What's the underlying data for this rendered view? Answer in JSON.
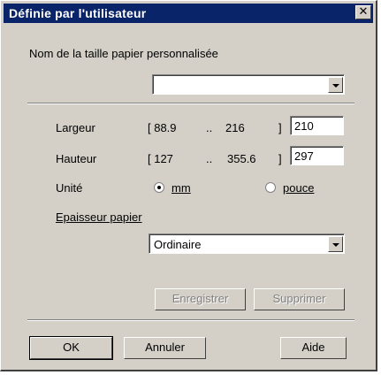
{
  "dialog": {
    "title": "Définie par l'utilisateur",
    "close_glyph": "✕"
  },
  "paper_name": {
    "label": "Nom de la taille papier personnalisée",
    "value": ""
  },
  "largeur": {
    "label": "Largeur",
    "range_min": "[ 88.9",
    "range_sep": "..",
    "range_max": "216",
    "range_close": "]",
    "value": "210"
  },
  "hauteur": {
    "label": "Hauteur",
    "range_min": "[ 127",
    "range_sep": "..",
    "range_max": "355.6",
    "range_close": "]",
    "value": "297"
  },
  "unite": {
    "label": "Unité",
    "options": [
      {
        "label": "mm",
        "selected": true
      },
      {
        "label": "pouce",
        "selected": false
      }
    ]
  },
  "epaisseur": {
    "label": "Epaisseur papier",
    "value": "Ordinaire"
  },
  "buttons": {
    "enregistrer": "Enregistrer",
    "supprimer": "Supprimer",
    "ok": "OK",
    "annuler": "Annuler",
    "aide": "Aide"
  },
  "colors": {
    "title_bar": "#0a246a",
    "face": "#d4d0c8"
  }
}
